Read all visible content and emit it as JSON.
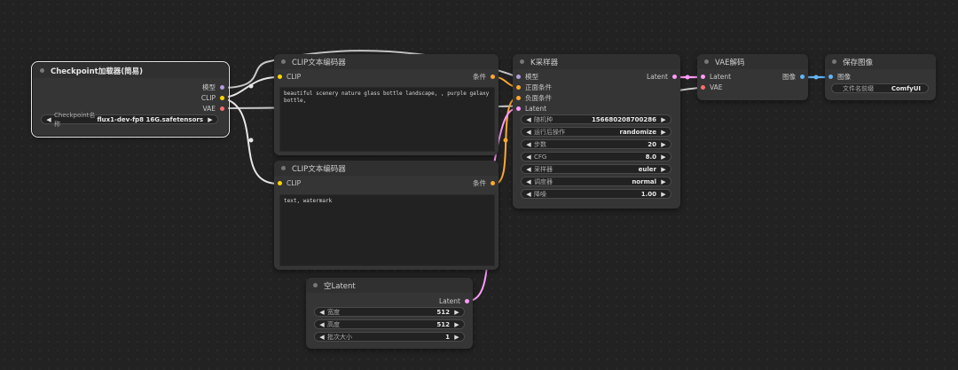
{
  "colors": {
    "model": "#b39ddb",
    "clip": "#ffd500",
    "vae": "#ff6e6e",
    "conditioning": "#ffa931",
    "latent": "#ff9cf9",
    "image": "#64b5f6",
    "link_white": "#e6e6e6"
  },
  "checkpoint": {
    "title": "Checkpoint加载器(简易)",
    "out_model": "模型",
    "out_clip": "CLIP",
    "out_vae": "VAE",
    "w_label": "Checkpoint名称",
    "w_value": "flux1-dev-fp8 16G.safetensors"
  },
  "clip_pos": {
    "title": "CLIP文本编码器",
    "in_clip": "CLIP",
    "out_cond": "条件",
    "text": "beautiful scenery nature glass bottle landscape, , purple galaxy bottle,"
  },
  "clip_neg": {
    "title": "CLIP文本编码器",
    "in_clip": "CLIP",
    "out_cond": "条件",
    "text": "text, watermark"
  },
  "ksampler": {
    "title": "K采样器",
    "in_model": "模型",
    "in_pos": "正面条件",
    "in_neg": "负面条件",
    "in_latent": "Latent",
    "out_latent": "Latent",
    "widgets": [
      {
        "label": "随机种",
        "value": "156680208700286"
      },
      {
        "label": "运行后操作",
        "value": "randomize"
      },
      {
        "label": "步数",
        "value": "20"
      },
      {
        "label": "CFG",
        "value": "8.0"
      },
      {
        "label": "采样器",
        "value": "euler"
      },
      {
        "label": "调度器",
        "value": "normal"
      },
      {
        "label": "降噪",
        "value": "1.00"
      }
    ]
  },
  "vae_decode": {
    "title": "VAE解码",
    "in_latent": "Latent",
    "in_vae": "VAE",
    "out_image": "图像"
  },
  "save_image": {
    "title": "保存图像",
    "in_image": "图像",
    "w_label": "文件名前缀",
    "w_value": "ComfyUI"
  },
  "empty_latent": {
    "title": "空Latent",
    "out_latent": "Latent",
    "widgets": [
      {
        "label": "宽度",
        "value": "512"
      },
      {
        "label": "高度",
        "value": "512"
      },
      {
        "label": "批次大小",
        "value": "1"
      }
    ]
  }
}
